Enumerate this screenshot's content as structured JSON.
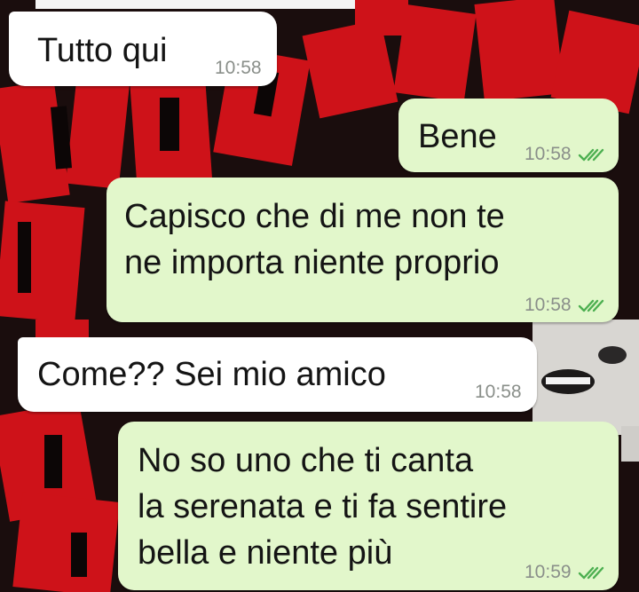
{
  "chat": {
    "messages": [
      {
        "direction": "incoming",
        "text": "Tutto qui",
        "time": "10:58"
      },
      {
        "direction": "outgoing",
        "text": "Bene",
        "time": "10:58",
        "status": "read"
      },
      {
        "direction": "outgoing",
        "text": "Capisco che di me non te\nne importa niente proprio",
        "time": "10:58",
        "status": "read"
      },
      {
        "direction": "incoming",
        "text": "Come?? Sei mio amico",
        "time": "10:58"
      },
      {
        "direction": "outgoing",
        "text": "No so uno che ti canta\nla serenata e ti fa sentire\nbella e niente più",
        "time": "10:59",
        "status": "read"
      }
    ]
  },
  "colors": {
    "incoming_bubble": "#ffffff",
    "outgoing_bubble": "#e2f7cb",
    "read_ticks": "#4fc3f7",
    "wallpaper_red": "#d8141b"
  },
  "icons": {
    "read_status": "double-check-icon"
  }
}
